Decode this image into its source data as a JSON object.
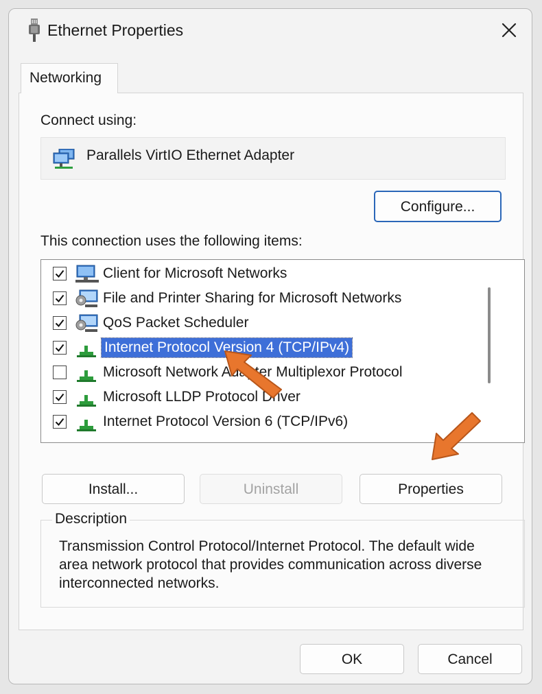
{
  "window": {
    "title": "Ethernet Properties",
    "icon": "ethernet-plug-icon"
  },
  "tabs": [
    {
      "label": "Networking",
      "selected": true
    }
  ],
  "connect_using": {
    "label": "Connect using:",
    "adapter_name": "Parallels VirtIO Ethernet Adapter",
    "adapter_icon": "network-adapter-icon",
    "configure_label": "Configure..."
  },
  "items": {
    "label": "This connection uses the following items:",
    "list": [
      {
        "label": "Client for Microsoft Networks",
        "checked": true,
        "icon": "network-client-icon"
      },
      {
        "label": "File and Printer Sharing for Microsoft Networks",
        "checked": true,
        "icon": "network-service-icon"
      },
      {
        "label": "QoS Packet Scheduler",
        "checked": true,
        "icon": "network-service-icon"
      },
      {
        "label": "Internet Protocol Version 4 (TCP/IPv4)",
        "checked": true,
        "icon": "protocol-icon",
        "selected": true
      },
      {
        "label": "Microsoft Network Adapter Multiplexor Protocol",
        "checked": false,
        "icon": "protocol-icon"
      },
      {
        "label": "Microsoft LLDP Protocol Driver",
        "checked": true,
        "icon": "protocol-icon"
      },
      {
        "label": "Internet Protocol Version 6 (TCP/IPv6)",
        "checked": true,
        "icon": "protocol-icon"
      }
    ]
  },
  "buttons": {
    "install": "Install...",
    "uninstall": "Uninstall",
    "properties": "Properties",
    "ok": "OK",
    "cancel": "Cancel"
  },
  "description": {
    "legend": "Description",
    "text": "Transmission Control Protocol/Internet Protocol. The default wide area network protocol that provides communication across diverse interconnected networks."
  },
  "colors": {
    "selection": "#3e6fd8",
    "accent_border": "#2a66b8",
    "annotation_arrow": "#e8762d"
  }
}
